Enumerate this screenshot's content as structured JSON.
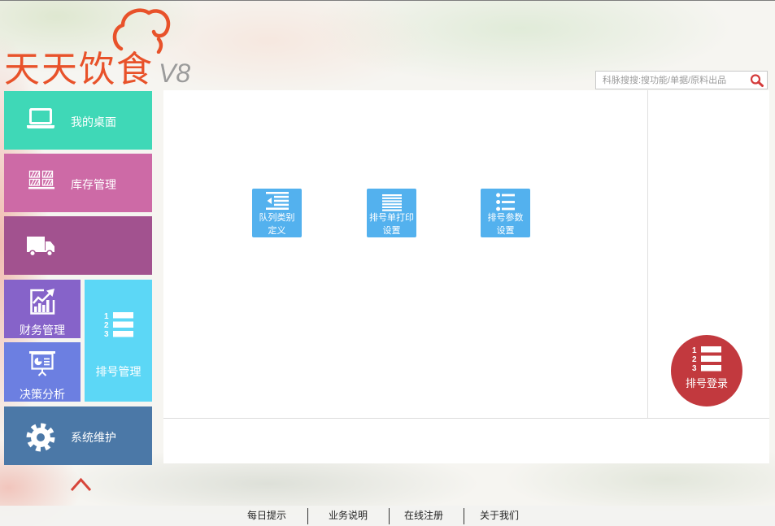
{
  "app": {
    "logo_text": "天天饮食",
    "version": "V8",
    "brand_color": "#e8522a",
    "logo_icon": "chef-hat-icon"
  },
  "search": {
    "placeholder": "科脉搜搜:搜功能/单据/原料出品",
    "value": "",
    "icon": "search-icon"
  },
  "icons": {
    "list_digits": [
      "1",
      "2",
      "3"
    ]
  },
  "sidebar": {
    "tiles": [
      {
        "label": "我的桌面",
        "icon": "laptop-icon",
        "color": "#3fd8b7"
      },
      {
        "label": "库存管理",
        "icon": "warehouse-shelf-icon",
        "color": "#cd6aa6"
      },
      {
        "icon": "truck-icon",
        "color": "#a2528f"
      },
      {
        "label": "财务管理",
        "icon": "finance-chart-icon",
        "color": "#8663c9"
      },
      {
        "label": "排号管理",
        "icon": "numbered-list-icon",
        "color": "#5cd7f6"
      },
      {
        "label": "决策分析",
        "icon": "presentation-icon",
        "color": "#6c7fe1"
      },
      {
        "label": "系统维护",
        "icon": "gear-icon",
        "color": "#4b78a7"
      }
    ],
    "collapse_icon": "chevron-up-icon"
  },
  "main": {
    "button_color": "#53b1ee",
    "buttons": [
      {
        "label_lines": [
          "队列类别",
          "定义"
        ],
        "icon": "indent-list-icon"
      },
      {
        "label_lines": [
          "排号单打印",
          "设置"
        ],
        "icon": "lines-icon"
      },
      {
        "label_lines": [
          "排号参数",
          "设置"
        ],
        "icon": "bullet-list-icon"
      }
    ]
  },
  "side": {
    "action": {
      "label": "排号登录",
      "icon": "numbered-list-icon",
      "color": "#c2393e"
    }
  },
  "footer": {
    "links": [
      "每日提示",
      "业务说明",
      "在线注册",
      "关于我们"
    ]
  }
}
